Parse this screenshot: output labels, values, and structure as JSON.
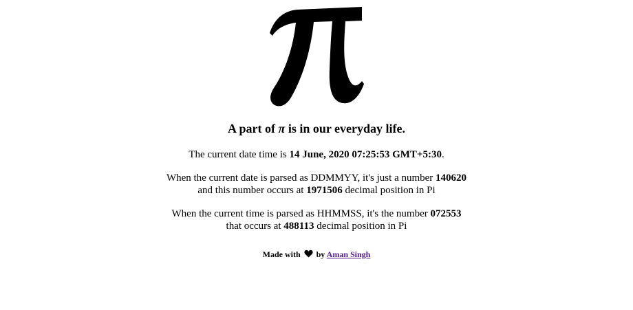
{
  "logo": {
    "icon": "pi-symbol-icon",
    "color": "#000000"
  },
  "headline": {
    "prefix": "A part of ",
    "pi": "π",
    "suffix": " is in our everyday life."
  },
  "datetime_line": {
    "prefix": "The current date time is ",
    "value": "14 June, 2020 07:25:53 GMT+5:30",
    "suffix": "."
  },
  "date_section": {
    "line1_prefix": "When the current date is parsed as DDMMYY, it's just a number ",
    "number": "140620",
    "line2_prefix": "and this number occurs at ",
    "position": "1971506",
    "line2_suffix": " decimal position in Pi"
  },
  "time_section": {
    "line1_prefix": "When the current time is parsed as HHMMSS, it's the number ",
    "number": "072553",
    "line2_prefix": "that occurs at ",
    "position": "488113",
    "line2_suffix": " decimal position in Pi"
  },
  "footer": {
    "made_with": "Made with",
    "heart_icon": "heart-icon",
    "by": "by",
    "author_link": "Aman Singh",
    "link_color": "#551a8b"
  }
}
